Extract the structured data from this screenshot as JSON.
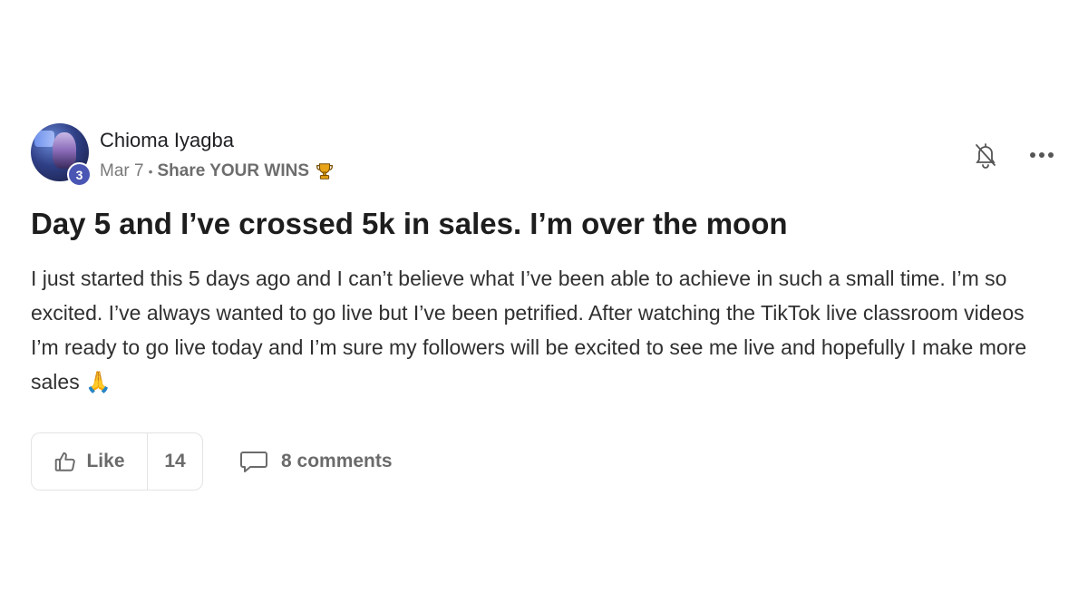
{
  "post": {
    "author": "Chioma Iyagba",
    "level": "3",
    "date": "Mar 7",
    "separator": "•",
    "category": "Share YOUR WINS",
    "title": "Day 5 and I’ve crossed 5k in sales. I’m over the moon",
    "body": "I just started this 5 days ago and I can’t believe what I’ve been able to achieve in such a small time. I’m so excited. I’ve always wanted to go live but I’ve been petrified. After watching the TikTok live classroom videos I’m ready to go live today and I’m sure my followers will be excited to see me live and hopefully I make more sales 🙏"
  },
  "footer": {
    "like_label": "Like",
    "like_count": "14",
    "comments_label": "8 comments"
  },
  "icons": {
    "trophy": "trophy-icon",
    "bell": "bell-off-icon",
    "more": "more-horizontal-icon",
    "like": "thumbs-up-icon",
    "comment": "comment-icon"
  },
  "colors": {
    "badge": "#4a56b3",
    "trophy": "#e8a317",
    "text_muted": "#6b6b6b"
  }
}
